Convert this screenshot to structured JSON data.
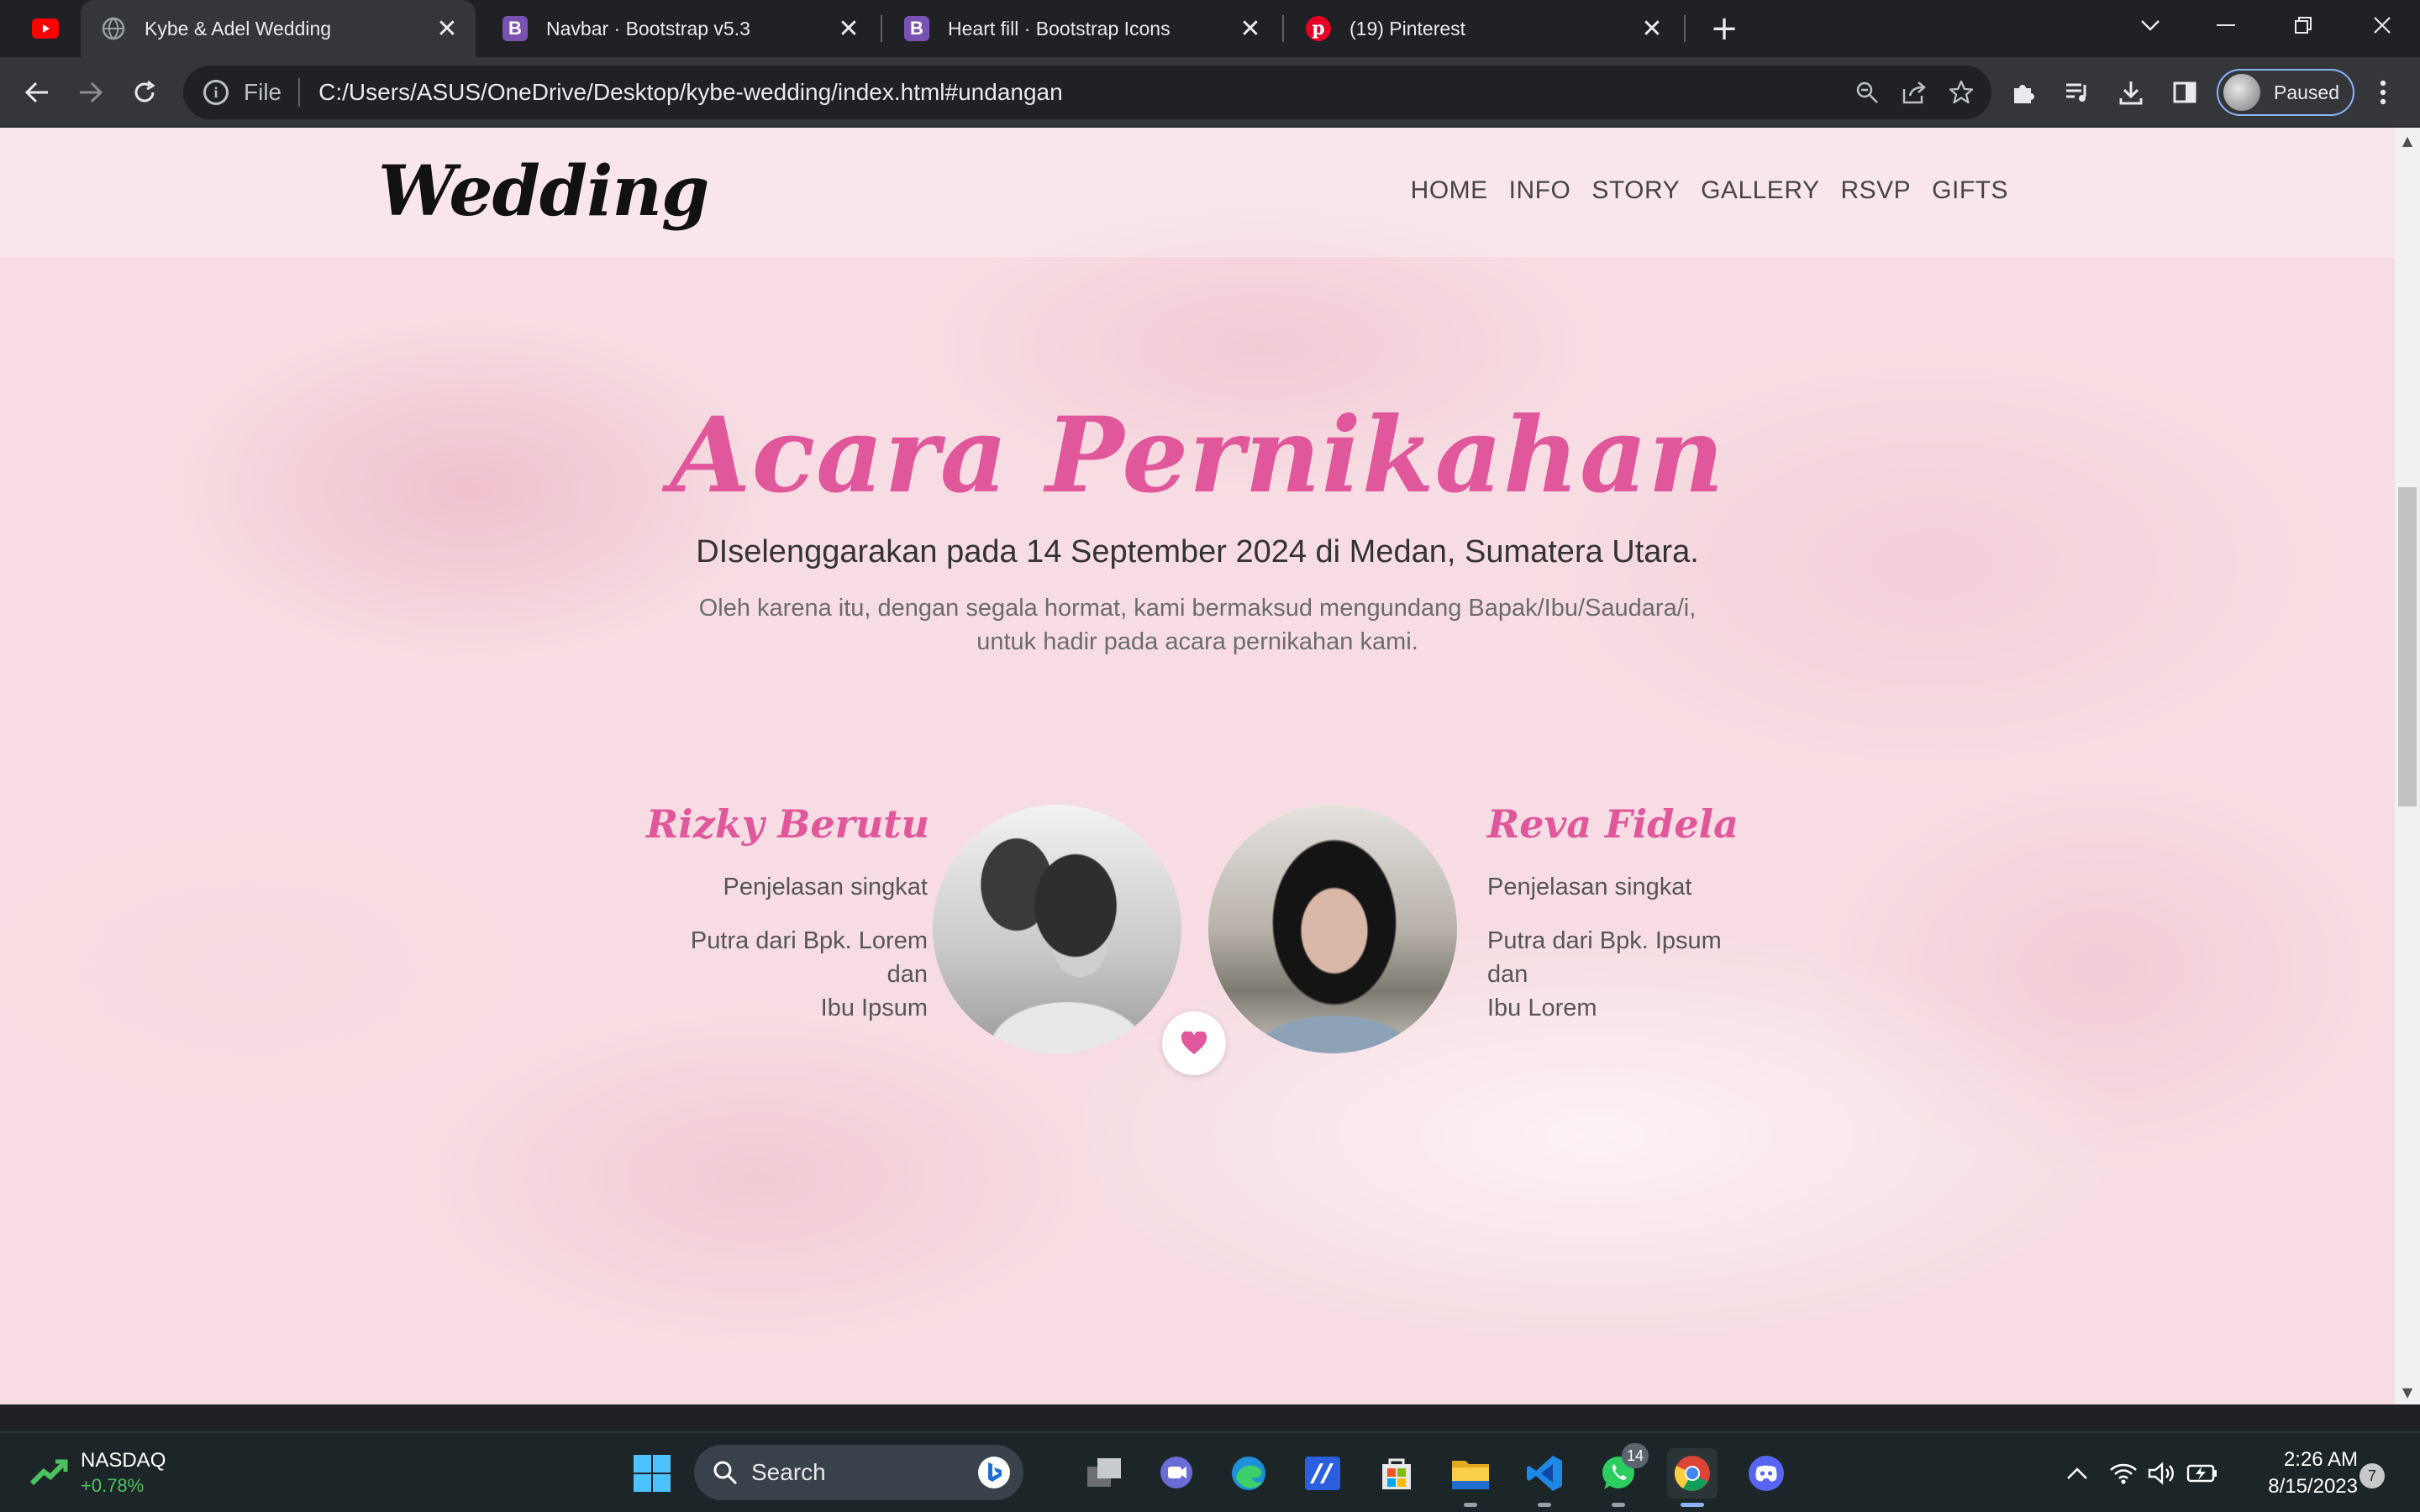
{
  "browser": {
    "tabs": [
      {
        "title": "Kybe & Adel Wedding",
        "favicon": "globe-icon",
        "active": true
      },
      {
        "title": "Navbar · Bootstrap v5.3",
        "favicon": "bootstrap-icon",
        "active": false
      },
      {
        "title": "Heart fill · Bootstrap Icons",
        "favicon": "bootstrap-icon",
        "active": false
      },
      {
        "title": "(19) Pinterest",
        "favicon": "pinterest-icon",
        "active": false
      }
    ],
    "omnibox": {
      "scheme_label": "File",
      "url": "C:/Users/ASUS/OneDrive/Desktop/kybe-wedding/index.html#undangan"
    },
    "profile_label": "Paused"
  },
  "page": {
    "brand": "Wedding",
    "nav": [
      "HOME",
      "INFO",
      "STORY",
      "GALLERY",
      "RSVP",
      "GIFTS"
    ],
    "section": {
      "title": "Acara Pernikahan",
      "subtitle": "DIselenggarakan pada 14 September 2024 di Medan, Sumatera Utara.",
      "desc_line1": "Oleh karena itu, dengan segala hormat, kami bermaksud mengundang Bapak/Ibu/Saudara/i,",
      "desc_line2": "untuk hadir pada acara pernikahan kami."
    },
    "groom": {
      "name": "Rizky Berutu",
      "short": "Penjelasan singkat",
      "parent_l1": "Putra dari Bpk. Lorem",
      "parent_l2": "dan",
      "parent_l3": "Ibu Ipsum"
    },
    "bride": {
      "name": "Reva Fidela",
      "short": "Penjelasan singkat",
      "parent_l1": "Putra dari Bpk. Ipsum",
      "parent_l2": "dan",
      "parent_l3": "Ibu Lorem"
    }
  },
  "taskbar": {
    "stock_name": "NASDAQ",
    "stock_change": "+0.78%",
    "search_placeholder": "Search",
    "whatsapp_badge": "14",
    "time": "2:26 AM",
    "date": "8/15/2023",
    "notification_count": "7"
  },
  "colors": {
    "accent_pink": "#e0579b",
    "chrome_dark": "#202124",
    "chrome_toolbar": "#35363a",
    "taskbar": "#1c2628"
  }
}
